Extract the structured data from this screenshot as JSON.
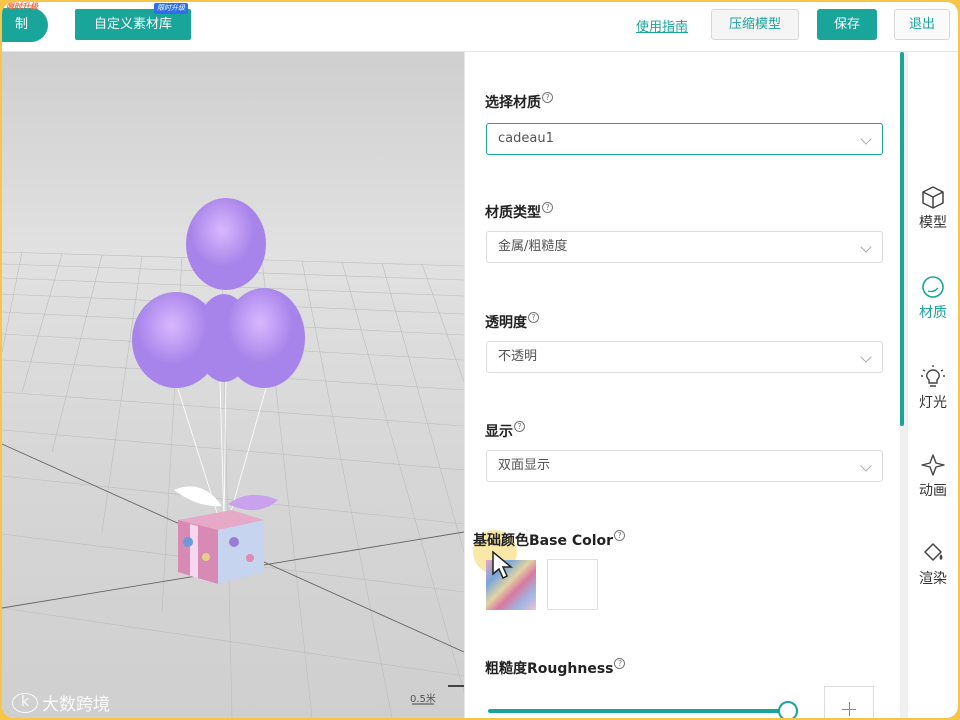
{
  "topbar": {
    "left_button_label": "制",
    "left_button_tag": "限时升级",
    "material_library_label": "自定义素材库",
    "material_library_tag": "限时升级",
    "guide_link": "使用指南",
    "compress_label": "压缩模型",
    "save_label": "保存",
    "exit_label": "退出"
  },
  "viewport": {
    "scale_label": "0.5米",
    "watermark": "大数跨境"
  },
  "panel": {
    "select_material_label": "选择材质",
    "select_material_value": "cadeau1",
    "material_type_label": "材质类型",
    "material_type_value": "金属/粗糙度",
    "transparency_label": "透明度",
    "transparency_value": "不透明",
    "display_label": "显示",
    "display_value": "双面显示",
    "base_color_label": "基础颜色Base Color",
    "roughness_label": "粗糙度Roughness",
    "roughness_value": 1.0
  },
  "tabs": [
    {
      "label": "模型",
      "icon": "cube-icon",
      "active": false
    },
    {
      "label": "材质",
      "icon": "material-sphere-icon",
      "active": true
    },
    {
      "label": "灯光",
      "icon": "lightbulb-icon",
      "active": false
    },
    {
      "label": "动画",
      "icon": "sparkle-icon",
      "active": false
    },
    {
      "label": "渲染",
      "icon": "paint-bucket-icon",
      "active": false
    }
  ],
  "colors": {
    "accent": "#19a59a",
    "balloon": "#b48ff0",
    "frame": "#f7c548"
  }
}
